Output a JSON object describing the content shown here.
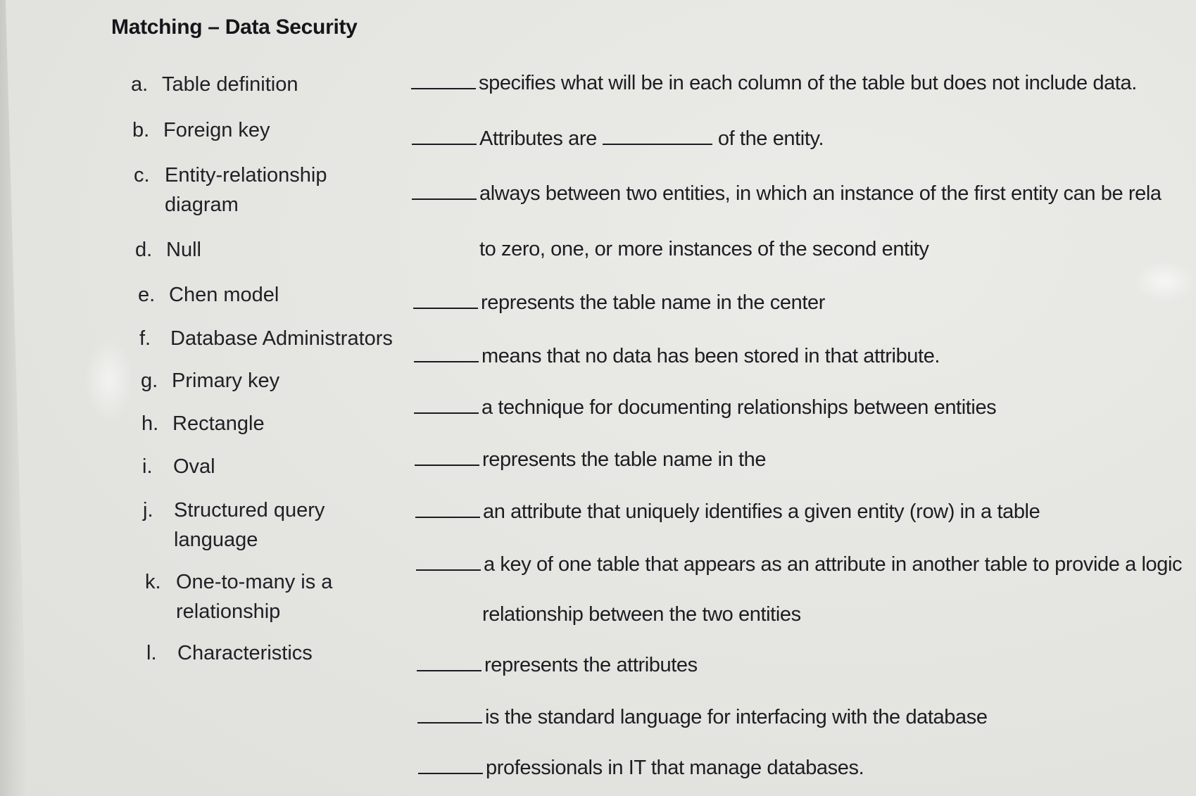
{
  "title": "Matching – Data Security",
  "terms": [
    {
      "letter": "a.",
      "text": "Table definition"
    },
    {
      "letter": "b.",
      "text": "Foreign key"
    },
    {
      "letter": "c.",
      "text": "Entity-relationship",
      "text2": "diagram"
    },
    {
      "letter": "d.",
      "text": "Null"
    },
    {
      "letter": "e.",
      "text": "Chen model"
    },
    {
      "letter": "f.",
      "text": "Database Administrators"
    },
    {
      "letter": "g.",
      "text": "Primary key"
    },
    {
      "letter": "h.",
      "text": "Rectangle"
    },
    {
      "letter": "i.",
      "text": "Oval"
    },
    {
      "letter": "j.",
      "text": "Structured query",
      "text2": "language"
    },
    {
      "letter": "k.",
      "text": "One-to-many is a",
      "text2": "relationship"
    },
    {
      "letter": "l.",
      "text": "Characteristics"
    }
  ],
  "definitions": [
    {
      "text": "specifies what will be in each column of the table but does not include data."
    },
    {
      "text": "Attributes are",
      "text_after": "of the entity."
    },
    {
      "text": "always between two entities, in which an instance of the first entity can be rela"
    },
    {
      "text": "to zero, one, or more instances of the second entity"
    },
    {
      "text": "represents the table name in the center"
    },
    {
      "text": "means that no data has been stored in that attribute."
    },
    {
      "text": "a technique for documenting relationships between entities"
    },
    {
      "text": "represents the table name in the"
    },
    {
      "text": "an attribute that uniquely identifies a given entity (row) in a table"
    },
    {
      "text": "a key of one table that appears as an attribute in another table to provide a logic"
    },
    {
      "text": "relationship between the two entities"
    },
    {
      "text": "represents the attributes"
    },
    {
      "text": "is the standard language for interfacing with the database"
    },
    {
      "text": "professionals in IT that manage databases."
    }
  ]
}
